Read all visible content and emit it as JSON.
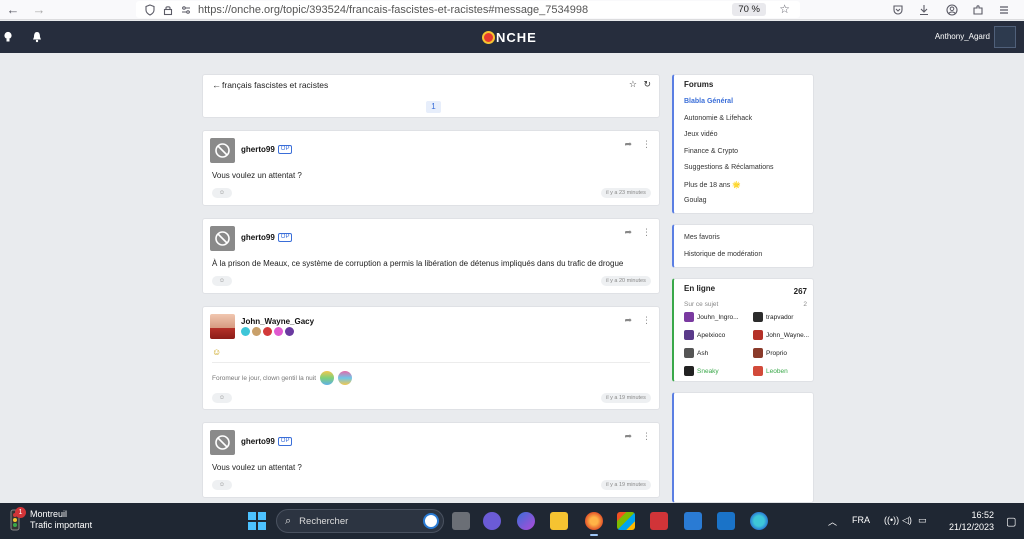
{
  "browser": {
    "url": "https://onche.org/topic/393524/francais-fascistes-et-racistes#message_7534998",
    "zoom": "70 %"
  },
  "header": {
    "logo_text": "NCHE",
    "username": "Anthony_Agard"
  },
  "topic": {
    "title": "français fascistes et racistes",
    "page": "1"
  },
  "posts": [
    {
      "author": "gherto99",
      "op_badge": "OP",
      "text": "Vous voulez un attentat ?",
      "time": "il y a 23 minutes"
    },
    {
      "author": "gherto99",
      "op_badge": "OP",
      "text": "À la prison de Meaux, ce système de corruption a permis la libération de détenus impliqués dans du trafic de drogue",
      "time": "il y a 20 minutes"
    },
    {
      "author": "John_Wayne_Gacy",
      "text": "☺",
      "signature": "Foromeur le jour, clown gentil la nuit",
      "time": "il y a 19 minutes"
    },
    {
      "author": "gherto99",
      "op_badge": "OP",
      "text": "Vous voulez un attentat ?",
      "time": "il y a 19 minutes"
    }
  ],
  "sidebar": {
    "forums_title": "Forums",
    "forums": [
      {
        "label": "Blabla Général",
        "active": true
      },
      {
        "label": "Autonomie & Lifehack"
      },
      {
        "label": "Jeux vidéo"
      },
      {
        "label": "Finance & Crypto"
      },
      {
        "label": "Suggestions & Réclamations"
      },
      {
        "label": "Plus de 18 ans 🌟"
      },
      {
        "label": "Goulag"
      }
    ],
    "links": [
      "Mes favoris",
      "Historique de modération"
    ],
    "online": {
      "title": "En ligne",
      "count": "267",
      "subject_label": "Sur ce sujet",
      "subject_count": "2",
      "users": [
        {
          "name": "Jouhn_Ingro...",
          "color": "#7a3aa0"
        },
        {
          "name": "trapvador",
          "color": "#2b2b2b"
        },
        {
          "name": "Apelxioco",
          "color": "#5a3a8a"
        },
        {
          "name": "John_Wayne...",
          "color": "#b53128"
        },
        {
          "name": "Ash",
          "color": "#555"
        },
        {
          "name": "Proprio",
          "color": "#8a3a2a"
        },
        {
          "name": "Sneaky",
          "color": "#222",
          "green": true
        },
        {
          "name": "Leoben",
          "color": "#d24a3a",
          "green": true
        }
      ]
    }
  },
  "taskbar": {
    "weather_city": "Montreuil",
    "weather_status": "Trafic important",
    "notif_count": "1",
    "search_placeholder": "Rechercher",
    "language": "FRA",
    "time": "16:52",
    "date": "21/12/2023"
  }
}
